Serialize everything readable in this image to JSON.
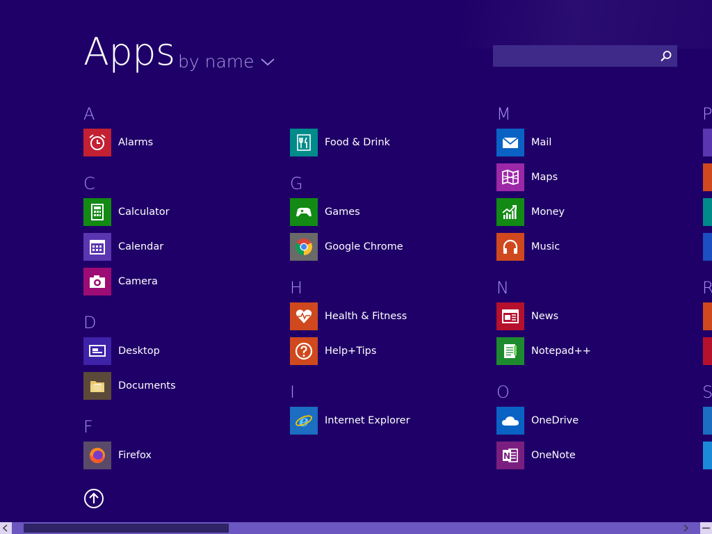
{
  "header": {
    "title": "Apps",
    "sort_label": "by name",
    "search_placeholder": ""
  },
  "groups": [
    {
      "letter": "A",
      "apps": [
        {
          "name": "Alarms",
          "icon": "alarm-clock-icon",
          "color": "#c32034"
        }
      ]
    },
    {
      "letter": "",
      "apps": [
        {
          "name": "Food & Drink",
          "icon": "fork-knife-icon",
          "color": "#008b8b"
        }
      ]
    },
    {
      "letter": "C",
      "apps": [
        {
          "name": "Calculator",
          "icon": "calculator-icon",
          "color": "#128a14"
        },
        {
          "name": "Calendar",
          "icon": "calendar-icon",
          "color": "#5a36b0"
        },
        {
          "name": "Camera",
          "icon": "camera-icon",
          "color": "#9c0c74"
        }
      ]
    },
    {
      "letter": "D",
      "apps": [
        {
          "name": "Desktop",
          "icon": "desktop-icon",
          "color": "#3e22a8"
        },
        {
          "name": "Documents",
          "icon": "folder-icon",
          "color": "#5b4a3a"
        }
      ]
    },
    {
      "letter": "F",
      "apps": [
        {
          "name": "Firefox",
          "icon": "firefox-icon",
          "color": "#5a4a6a"
        }
      ]
    },
    {
      "letter": "G",
      "apps": [
        {
          "name": "Games",
          "icon": "gamepad-icon",
          "color": "#128a14"
        },
        {
          "name": "Google Chrome",
          "icon": "chrome-icon",
          "color": "#6a6a6a"
        }
      ]
    },
    {
      "letter": "H",
      "apps": [
        {
          "name": "Health & Fitness",
          "icon": "heart-pulse-icon",
          "color": "#d0491e"
        },
        {
          "name": "Help+Tips",
          "icon": "question-icon",
          "color": "#d0491e"
        }
      ]
    },
    {
      "letter": "I",
      "apps": [
        {
          "name": "Internet Explorer",
          "icon": "internet-explorer-icon",
          "color": "#1b6ec2"
        }
      ]
    },
    {
      "letter": "M",
      "apps": [
        {
          "name": "Mail",
          "icon": "mail-icon",
          "color": "#0a63c4"
        },
        {
          "name": "Maps",
          "icon": "map-icon",
          "color": "#9c28a8"
        },
        {
          "name": "Money",
          "icon": "chart-icon",
          "color": "#128a14"
        },
        {
          "name": "Music",
          "icon": "headphones-icon",
          "color": "#d0491e"
        }
      ]
    },
    {
      "letter": "N",
      "apps": [
        {
          "name": "News",
          "icon": "newspaper-icon",
          "color": "#b5102c"
        },
        {
          "name": "Notepad++",
          "icon": "notepad-icon",
          "color": "#1e8a2e"
        }
      ]
    },
    {
      "letter": "O",
      "apps": [
        {
          "name": "OneDrive",
          "icon": "cloud-icon",
          "color": "#0a63c4"
        },
        {
          "name": "OneNote",
          "icon": "onenote-icon",
          "color": "#7a1f7f"
        }
      ]
    }
  ],
  "partial_letters": [
    "P",
    "R",
    "S"
  ],
  "partial_tile_colors": [
    "#5a36b0",
    "#d0491e",
    "#008b8b",
    "#1b4fc2",
    "#d0491e",
    "#b5102c",
    "#1b6ec2",
    "#1b8ad8"
  ],
  "colors": {
    "background": "#1f0068",
    "letter": "#a98cf7",
    "sort": "#a99ae0",
    "scroll_track": "#6c57c0",
    "scroll_thumb": "#2e2466"
  }
}
